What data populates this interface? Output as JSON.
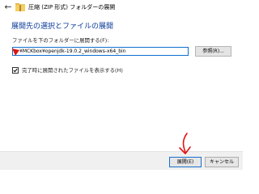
{
  "window": {
    "title": "圧縮 (ZIP 形式) フォルダーの展開",
    "back_icon": "back-arrow-icon",
    "app_icon": "zip-folder-icon"
  },
  "dialog": {
    "heading": "展開先の選択とファイルの展開",
    "destination_label": "ファイルを下のフォルダーに展開する(F):",
    "destination_value": "¥MCKbox¥openjdk-19.0.2_windows-x64_bin",
    "browse_label": "参照(R)...",
    "show_files_label": "完了時に展開されたファイルを表示する(H)",
    "show_files_checked": true
  },
  "footer": {
    "extract_label": "展開(E)",
    "cancel_label": "キャンセル"
  },
  "colors": {
    "heading": "#0a3a9a",
    "focus_border": "#0f6fd0",
    "annotation": "#e01414"
  }
}
